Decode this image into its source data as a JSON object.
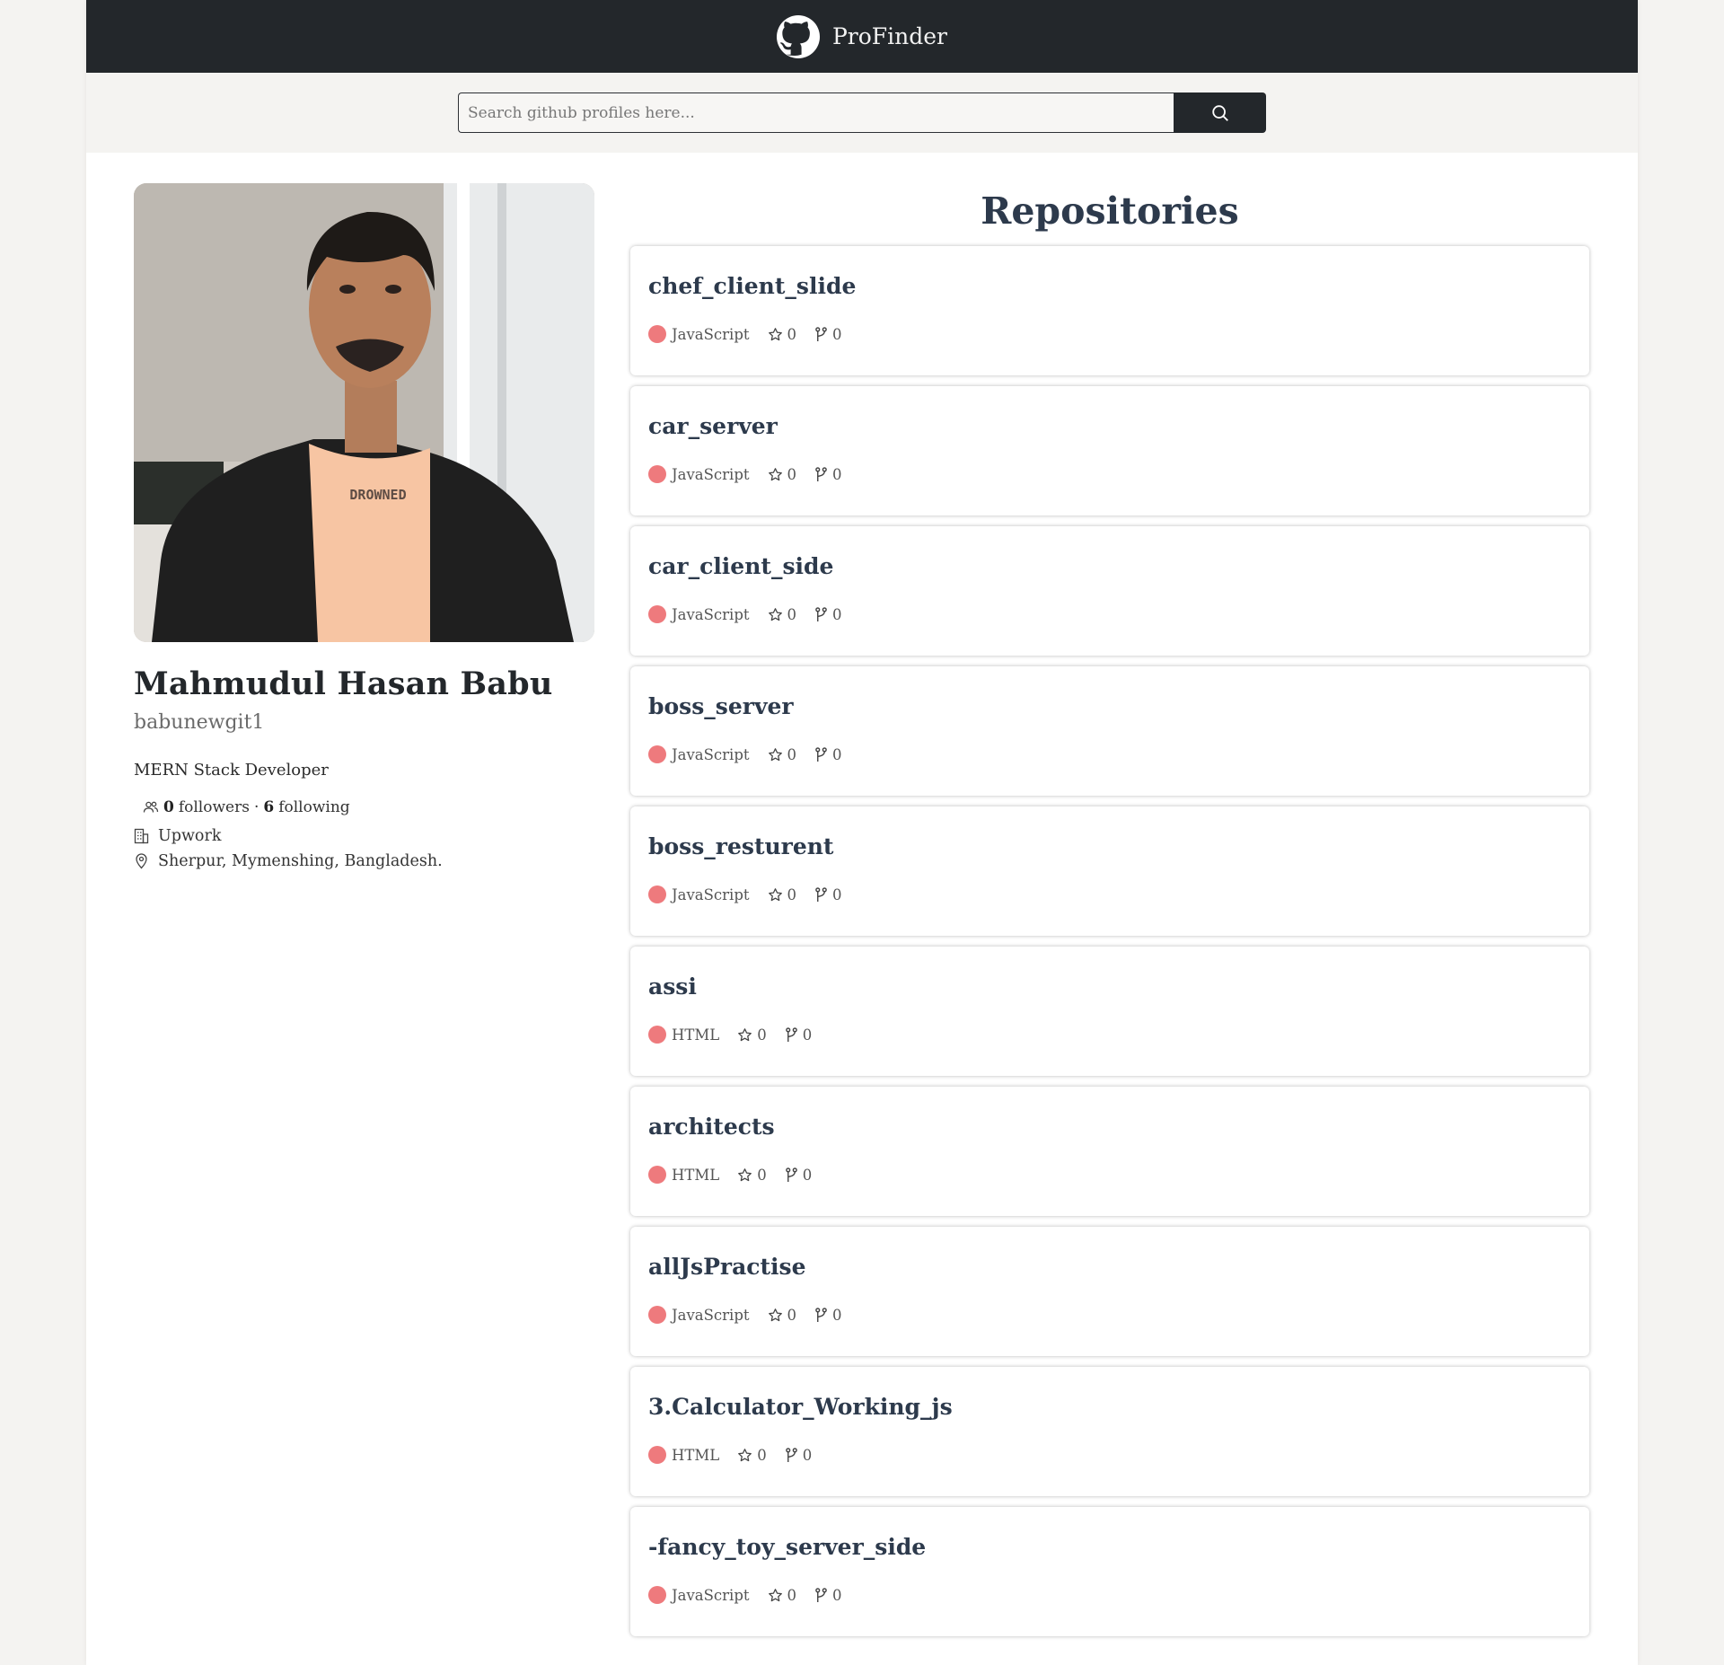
{
  "header": {
    "brand": "ProFinder",
    "brand_icon": "github-icon"
  },
  "search": {
    "placeholder": "Search github profiles here...",
    "value": "",
    "button_icon": "search-icon"
  },
  "profile": {
    "name": "Mahmudul Hasan Babu",
    "username": "babunewgit1",
    "bio": "MERN Stack Developer",
    "followers": "0",
    "followers_label": "followers",
    "separator": "·",
    "following": "6",
    "following_label": "following",
    "company": "Upwork",
    "location": "Sherpur, Mymenshing, Bangladesh.",
    "avatar_shirt_text": "DROWNED"
  },
  "repositories": {
    "title": "Repositories",
    "language_color": "#ee7a7d",
    "items": [
      {
        "name": "chef_client_slide",
        "language": "JavaScript",
        "stars": "0",
        "forks": "0"
      },
      {
        "name": "car_server",
        "language": "JavaScript",
        "stars": "0",
        "forks": "0"
      },
      {
        "name": "car_client_side",
        "language": "JavaScript",
        "stars": "0",
        "forks": "0"
      },
      {
        "name": "boss_server",
        "language": "JavaScript",
        "stars": "0",
        "forks": "0"
      },
      {
        "name": "boss_resturent",
        "language": "JavaScript",
        "stars": "0",
        "forks": "0"
      },
      {
        "name": "assi",
        "language": "HTML",
        "stars": "0",
        "forks": "0"
      },
      {
        "name": "architects",
        "language": "HTML",
        "stars": "0",
        "forks": "0"
      },
      {
        "name": "allJsPractise",
        "language": "JavaScript",
        "stars": "0",
        "forks": "0"
      },
      {
        "name": "3.Calculator_Working_js",
        "language": "HTML",
        "stars": "0",
        "forks": "0"
      },
      {
        "name": "-fancy_toy_server_side",
        "language": "JavaScript",
        "stars": "0",
        "forks": "0"
      }
    ]
  }
}
